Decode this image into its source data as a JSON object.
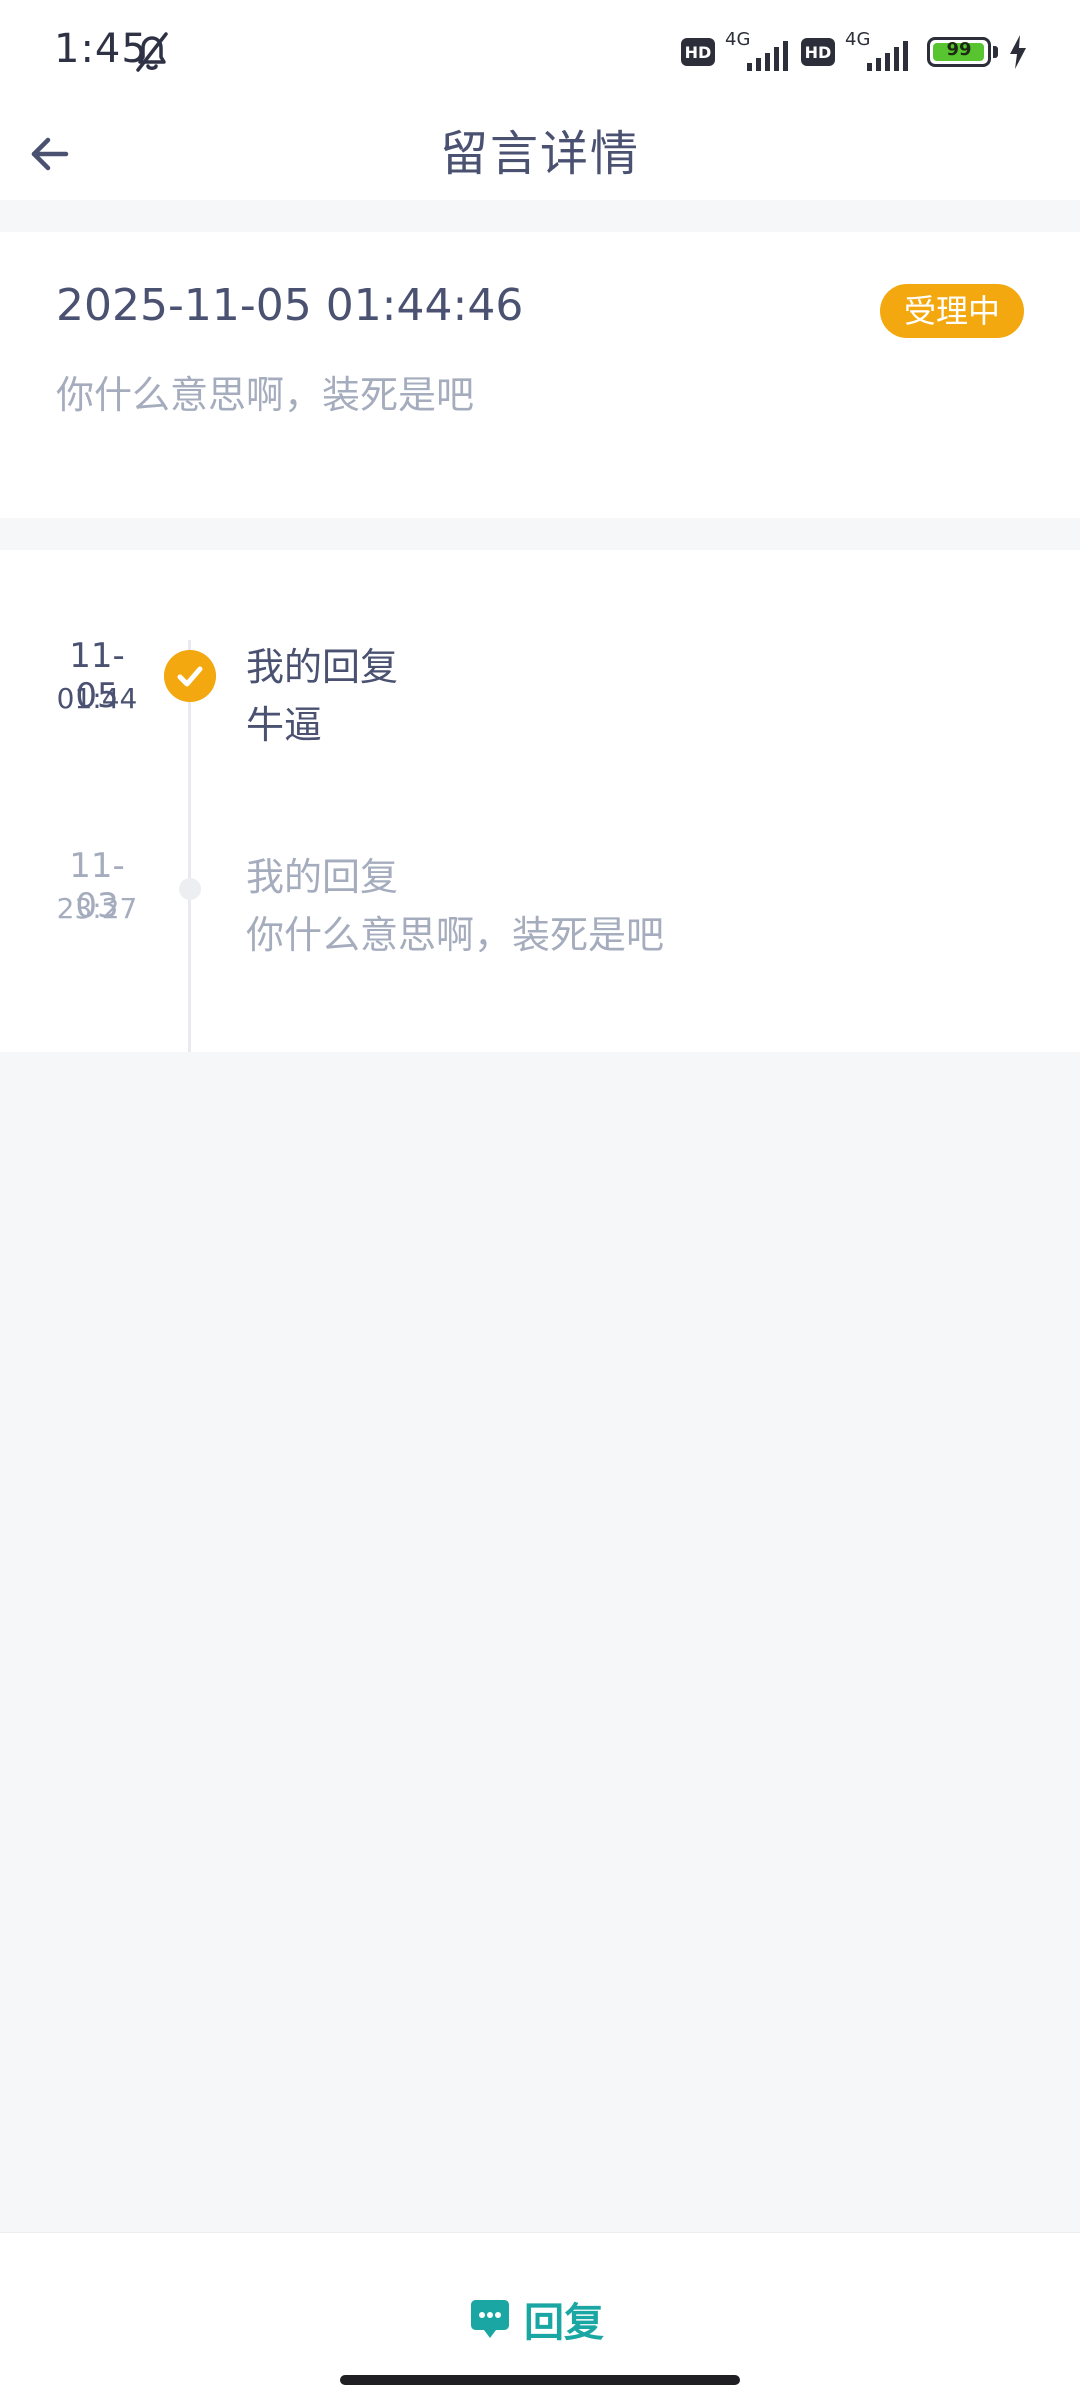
{
  "status_bar": {
    "time": "1:45",
    "network": [
      "4G",
      "4G"
    ],
    "hd_badge": "HD",
    "battery": "99",
    "battery_fraction": 0.99
  },
  "header": {
    "title": "留言详情"
  },
  "message": {
    "datetime": "2025-11-05 01:44:46",
    "status": "受理中",
    "content": "你什么意思啊，装死是吧"
  },
  "timeline": [
    {
      "date": "11-05",
      "time": "01:44",
      "title": "我的回复",
      "body": "牛逼"
    },
    {
      "date": "11-03",
      "time": "23:27",
      "title": "我的回复",
      "body": "你什么意思啊，装死是吧"
    }
  ],
  "bottom": {
    "reply_label": "回复"
  },
  "colors": {
    "accent_orange": "#f3a80f",
    "reply_teal": "#1aa7a3",
    "text_primary": "#4a5171",
    "text_muted": "#a5acbd"
  }
}
